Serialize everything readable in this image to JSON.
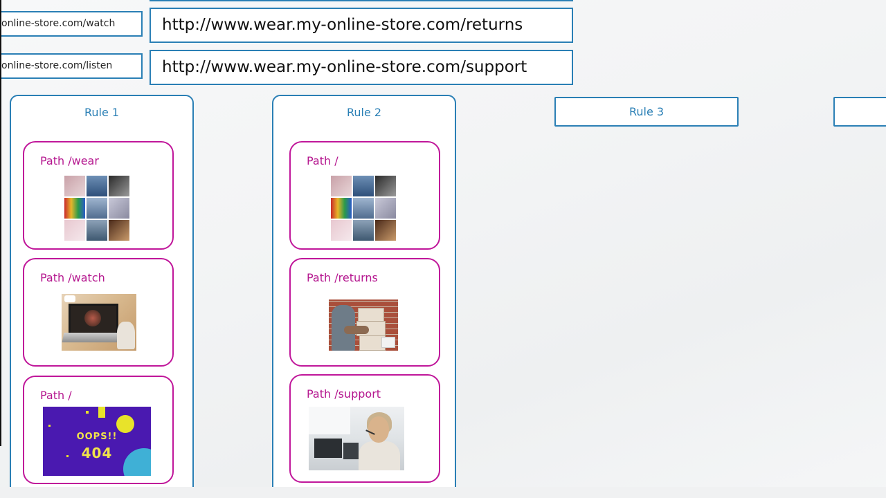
{
  "urls": {
    "small": [
      "online-store.com/watch",
      "online-store.com/listen"
    ],
    "big": [
      "http://www.wear.my-online-store.com/returns",
      "http://www.wear.my-online-store.com/support"
    ]
  },
  "rules": [
    {
      "title": "Rule 1",
      "paths": [
        {
          "label": "Path /wear",
          "image": "clothing-collage"
        },
        {
          "label": "Path /watch",
          "image": "laptop-video"
        },
        {
          "label": "Path /",
          "image": "oops-404"
        }
      ]
    },
    {
      "title": "Rule 2",
      "paths": [
        {
          "label": "Path /",
          "image": "clothing-collage"
        },
        {
          "label": "Path /returns",
          "image": "returns-boxes"
        },
        {
          "label": "Path /support",
          "image": "support-agent"
        }
      ]
    },
    {
      "title": "Rule 3"
    }
  ],
  "oops": {
    "line1": "OOPS!!",
    "line2": "404"
  },
  "colors": {
    "rule_border": "#2a7fb5",
    "path_border": "#c0169a",
    "path_text": "#b5178f"
  }
}
